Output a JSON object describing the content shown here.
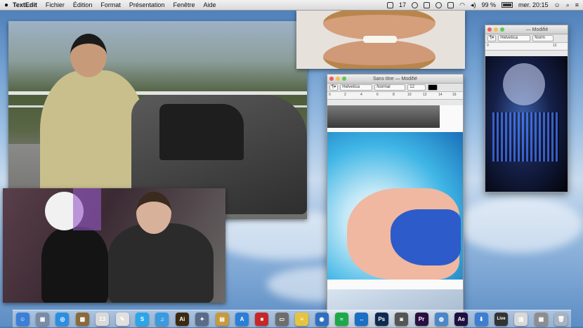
{
  "menubar": {
    "app_name": "TextEdit",
    "items": [
      "Fichier",
      "Édition",
      "Format",
      "Présentation",
      "Fenêtre",
      "Aide"
    ],
    "status_number": "17",
    "battery": "99 %",
    "clock": "mer. 20:15"
  },
  "windows": {
    "center": {
      "title": "Sans titre — Modifié",
      "font": "Helvetica",
      "style": "Normal",
      "size": "12",
      "ruler_marks": [
        "0",
        "2",
        "4",
        "6",
        "8",
        "10",
        "12",
        "14",
        "16"
      ]
    },
    "right": {
      "title": "— Modifié",
      "font": "Helvetica",
      "style": "Norm",
      "ruler_marks": [
        "0",
        "12"
      ]
    }
  },
  "dock": {
    "icons": [
      {
        "name": "finder-icon",
        "glyph": "☺",
        "color": "#3b7fd8"
      },
      {
        "name": "preview-icon",
        "glyph": "▣",
        "color": "#7a8ca5"
      },
      {
        "name": "safari-icon",
        "glyph": "◎",
        "color": "#2b8fe0"
      },
      {
        "name": "photo-icon",
        "glyph": "▩",
        "color": "#8a6a3a"
      },
      {
        "name": "calendar-icon",
        "glyph": "13",
        "color": "#d9d9d9"
      },
      {
        "name": "textedit-icon",
        "glyph": "✎",
        "color": "#e0e0e0"
      },
      {
        "name": "skype-icon",
        "glyph": "S",
        "color": "#2ba6e8"
      },
      {
        "name": "itunes-icon",
        "glyph": "♫",
        "color": "#3a9be0"
      },
      {
        "name": "illustrator-icon",
        "glyph": "Ai",
        "color": "#3b2a10"
      },
      {
        "name": "misc-icon",
        "glyph": "✦",
        "color": "#5a6c88"
      },
      {
        "name": "folder-icon",
        "glyph": "▤",
        "color": "#c69a3c"
      },
      {
        "name": "app-store-icon",
        "glyph": "A",
        "color": "#2a7fd6"
      },
      {
        "name": "red-app-icon",
        "glyph": "■",
        "color": "#c62828"
      },
      {
        "name": "capture-icon",
        "glyph": "▭",
        "color": "#6d6d6d"
      },
      {
        "name": "notes-icon",
        "glyph": "≡",
        "color": "#e6c440"
      },
      {
        "name": "globe-icon",
        "glyph": "◉",
        "color": "#2f6fbf"
      },
      {
        "name": "spotify-icon",
        "glyph": "≈",
        "color": "#1ea84a"
      },
      {
        "name": "teamviewer-icon",
        "glyph": "↔",
        "color": "#1b6fc4"
      },
      {
        "name": "photoshop-icon",
        "glyph": "Ps",
        "color": "#0e2a4f"
      },
      {
        "name": "camera-icon",
        "glyph": "◙",
        "color": "#555555"
      },
      {
        "name": "premiere-icon",
        "glyph": "Pr",
        "color": "#2a1040"
      },
      {
        "name": "browser-icon",
        "glyph": "◍",
        "color": "#4a88c8"
      },
      {
        "name": "after-effects-icon",
        "glyph": "Ae",
        "color": "#1d1040"
      },
      {
        "name": "downloads-icon",
        "glyph": "⬇",
        "color": "#3c7ed2"
      },
      {
        "name": "live-icon",
        "glyph": "Live",
        "color": "#333333"
      },
      {
        "name": "documents-icon",
        "glyph": "▥",
        "color": "#d8d8d8"
      },
      {
        "name": "stack-icon",
        "glyph": "▦",
        "color": "#8e8e8e"
      },
      {
        "name": "trash-icon",
        "glyph": "🗑",
        "color": "#a7b3c2"
      }
    ]
  }
}
